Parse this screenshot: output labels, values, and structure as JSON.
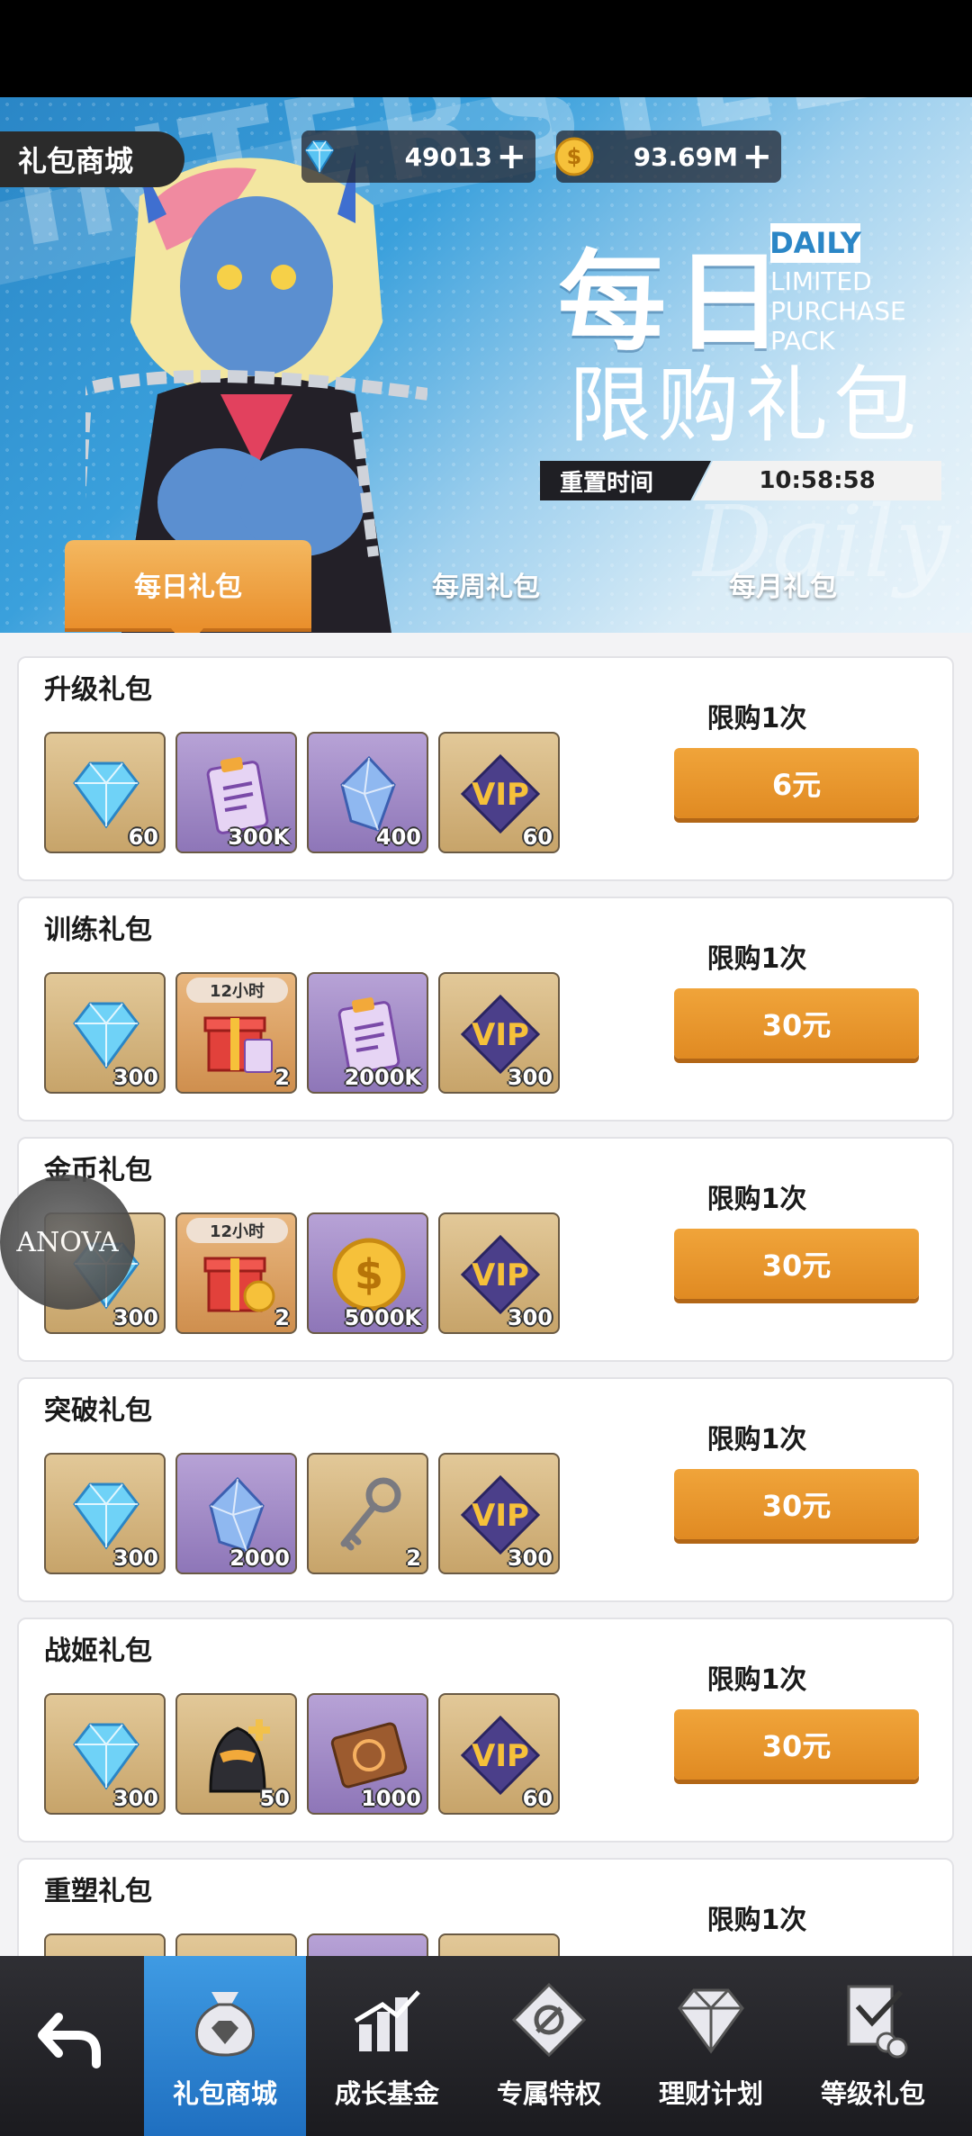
{
  "header": {
    "shop_title": "礼包商城",
    "diamonds": "49013",
    "gold": "93.69M",
    "plus": "+"
  },
  "banner": {
    "title_cn": "每日",
    "badge_en": "DAILY",
    "subtitle_en": "LIMITED PURCHASE PACK",
    "title_cn2": "限购礼包",
    "reset_label": "重置时间",
    "reset_time": "10:58:58",
    "bg_word": "INTERSTELLAR",
    "deco_script": "Daily"
  },
  "tabs": [
    {
      "label": "每日礼包",
      "active": true
    },
    {
      "label": "每周礼包",
      "active": false
    },
    {
      "label": "每月礼包",
      "active": false
    }
  ],
  "packs": [
    {
      "title": "升级礼包",
      "limit": "限购1次",
      "price": "6元",
      "items": [
        {
          "icon": "diamond",
          "qty": "60",
          "bg": "gold"
        },
        {
          "icon": "clipboard",
          "qty": "300K",
          "bg": "purple"
        },
        {
          "icon": "crystal",
          "qty": "400",
          "bg": "purple"
        },
        {
          "icon": "vip",
          "qty": "60",
          "bg": "gold"
        }
      ]
    },
    {
      "title": "训练礼包",
      "limit": "限购1次",
      "price": "30元",
      "items": [
        {
          "icon": "diamond",
          "qty": "300",
          "bg": "gold"
        },
        {
          "icon": "giftbox-clipboard",
          "qty": "2",
          "bg": "red",
          "tag": "12小时"
        },
        {
          "icon": "clipboard",
          "qty": "2000K",
          "bg": "purple"
        },
        {
          "icon": "vip",
          "qty": "300",
          "bg": "gold"
        }
      ]
    },
    {
      "title": "金币礼包",
      "limit": "限购1次",
      "price": "30元",
      "items": [
        {
          "icon": "diamond",
          "qty": "300",
          "bg": "gold"
        },
        {
          "icon": "giftbox-coin",
          "qty": "2",
          "bg": "red",
          "tag": "12小时"
        },
        {
          "icon": "coin",
          "qty": "5000K",
          "bg": "purple"
        },
        {
          "icon": "vip",
          "qty": "300",
          "bg": "gold"
        }
      ]
    },
    {
      "title": "突破礼包",
      "limit": "限购1次",
      "price": "30元",
      "items": [
        {
          "icon": "diamond",
          "qty": "300",
          "bg": "gold"
        },
        {
          "icon": "crystal",
          "qty": "2000",
          "bg": "purple"
        },
        {
          "icon": "key",
          "qty": "2",
          "bg": "gold"
        },
        {
          "icon": "vip",
          "qty": "300",
          "bg": "gold"
        }
      ]
    },
    {
      "title": "战姬礼包",
      "limit": "限购1次",
      "price": "30元",
      "items": [
        {
          "icon": "diamond",
          "qty": "300",
          "bg": "gold"
        },
        {
          "icon": "mech-head",
          "qty": "50",
          "bg": "gold"
        },
        {
          "icon": "ticket",
          "qty": "1000",
          "bg": "purple"
        },
        {
          "icon": "vip",
          "qty": "60",
          "bg": "gold"
        }
      ]
    },
    {
      "title": "重塑礼包",
      "limit": "限购1次",
      "price": "",
      "items": []
    }
  ],
  "watermark": "ANOVA",
  "nav": [
    {
      "label": "",
      "icon": "back-arrow-icon"
    },
    {
      "label": "礼包商城",
      "icon": "money-bag-icon",
      "active": true
    },
    {
      "label": "成长基金",
      "icon": "growth-chart-icon"
    },
    {
      "label": "专属特权",
      "icon": "privilege-card-icon"
    },
    {
      "label": "理财计划",
      "icon": "gem-icon"
    },
    {
      "label": "等级礼包",
      "icon": "level-doc-icon"
    }
  ],
  "colors": {
    "accent_orange": "#e98f2c",
    "nav_active": "#2b84d0",
    "banner_blue": "#3aa0dc"
  }
}
